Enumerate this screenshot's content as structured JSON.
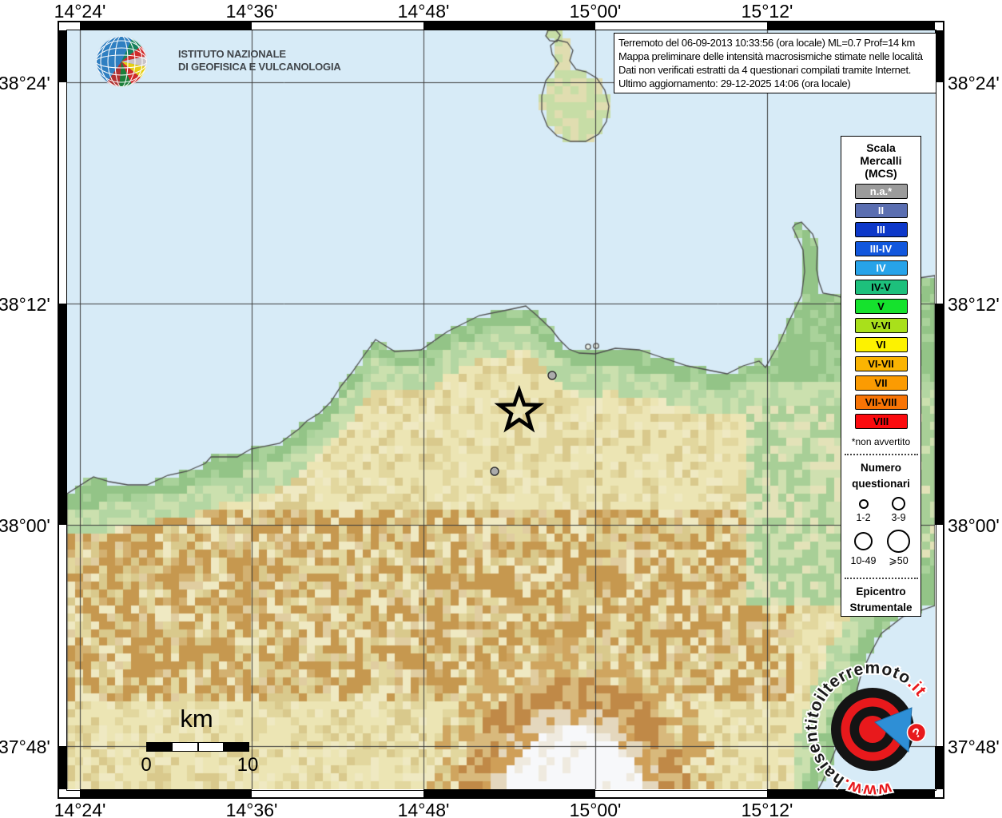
{
  "info_box": {
    "lines": [
      "Terremoto del 06-09-2013 10:33:56 (ora locale) ML=0.7 Prof=14 km",
      "Mappa preliminare delle intensità macrosismiche stimate nelle località",
      "Dati non verificati estratti da 4 questionari compilati tramite Internet.",
      "Ultimo aggiornamento: 29-12-2025 14:06 (ora locale)"
    ]
  },
  "branding": {
    "ingv_line1": "ISTITUTO NAZIONALE",
    "ingv_line2": "DI GEOFISICA E VULCANOLOGIA"
  },
  "axes": {
    "top": [
      "14°24'",
      "14°36'",
      "14°48'",
      "15°00'",
      "15°12'"
    ],
    "bottom": [
      "14°24'",
      "14°36'",
      "14°48'",
      "15°00'",
      "15°12'"
    ],
    "left": [
      "38°24'",
      "38°12'",
      "38°00'",
      "37°48'"
    ],
    "right": [
      "38°24'",
      "38°12'",
      "38°00'",
      "37°48'"
    ]
  },
  "legend": {
    "title_lines": [
      "Scala",
      "Mercalli",
      "(MCS)"
    ],
    "mcs_items": [
      {
        "label": "n.a.*",
        "color": "#9b9b9b",
        "text": "#ffffff"
      },
      {
        "label": "II",
        "color": "#5a6eb1",
        "text": "#ffffff"
      },
      {
        "label": "III",
        "color": "#0d38c9",
        "text": "#ffffff"
      },
      {
        "label": "III-IV",
        "color": "#1157dd",
        "text": "#ffffff"
      },
      {
        "label": "IV",
        "color": "#27a3e9",
        "text": "#ffffff"
      },
      {
        "label": "IV-V",
        "color": "#1dc07c",
        "text": "#000000"
      },
      {
        "label": "V",
        "color": "#15e22d",
        "text": "#000000"
      },
      {
        "label": "V-VI",
        "color": "#a9e01b",
        "text": "#000000"
      },
      {
        "label": "VI",
        "color": "#fdf200",
        "text": "#000000"
      },
      {
        "label": "VI-VII",
        "color": "#fab402",
        "text": "#000000"
      },
      {
        "label": "VII",
        "color": "#fb9b02",
        "text": "#000000"
      },
      {
        "label": "VII-VIII",
        "color": "#f87405",
        "text": "#000000"
      },
      {
        "label": "VIII",
        "color": "#fb0a0e",
        "text": "#000000"
      }
    ],
    "footnote": "*non avvertito",
    "questionnaire_title_lines": [
      "Numero",
      "questionari"
    ],
    "questionnaire_sizes": [
      {
        "label": "1-2"
      },
      {
        "label": "3-9"
      },
      {
        "label": "10-49"
      },
      {
        "label": "⩾50"
      }
    ],
    "epicenter_title_lines": [
      "Epicentro",
      "Strumentale"
    ]
  },
  "scalebar": {
    "unit": "km",
    "start_label": "0",
    "end_label": "10"
  },
  "watermark": {
    "prefix": "www.",
    "domain": "haisentitoilterremoto",
    "suffix": ".it",
    "question_mark": "?"
  },
  "map_markers": {
    "epicenter": {
      "fx": 0.521,
      "fy": 0.502
    },
    "questionnaire_points": [
      {
        "fx": 0.559,
        "fy": 0.455,
        "size": "1-2"
      },
      {
        "fx": 0.493,
        "fy": 0.581,
        "size": "1-2"
      }
    ]
  },
  "colors": {
    "sea": "#d7ebf7",
    "grid": "#3c3c3c",
    "na_marker": "#ababab",
    "accent_red": "#e8191c",
    "accent_blue": "#2e8fd6"
  }
}
